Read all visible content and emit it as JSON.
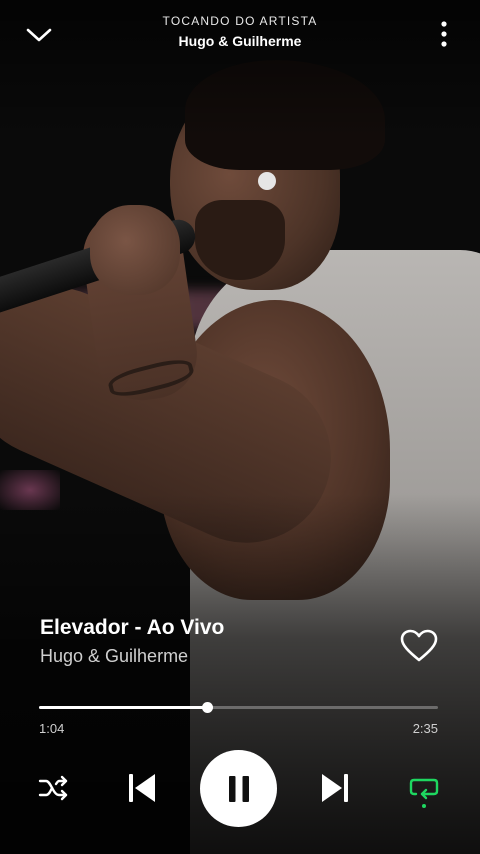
{
  "header": {
    "context_label": "TOCANDO DO ARTISTA",
    "artist_name": "Hugo & Guilherme"
  },
  "track": {
    "title": "Elevador - Ao Vivo",
    "artist": "Hugo & Guilherme",
    "liked": false
  },
  "playback": {
    "elapsed": "1:04",
    "total": "2:35",
    "progress_fraction": 0.42,
    "is_playing": true,
    "shuffle_on": false,
    "repeat_on": true
  },
  "icons": {
    "collapse": "chevron-down-icon",
    "menu": "more-vertical-icon",
    "like": "heart-outline-icon",
    "shuffle": "shuffle-icon",
    "previous": "skip-previous-icon",
    "pause": "pause-icon",
    "next": "skip-next-icon",
    "repeat": "repeat-icon"
  },
  "colors": {
    "accent": "#1ed760",
    "text_primary": "#ffffff",
    "text_secondary": "#cfcfcf"
  }
}
